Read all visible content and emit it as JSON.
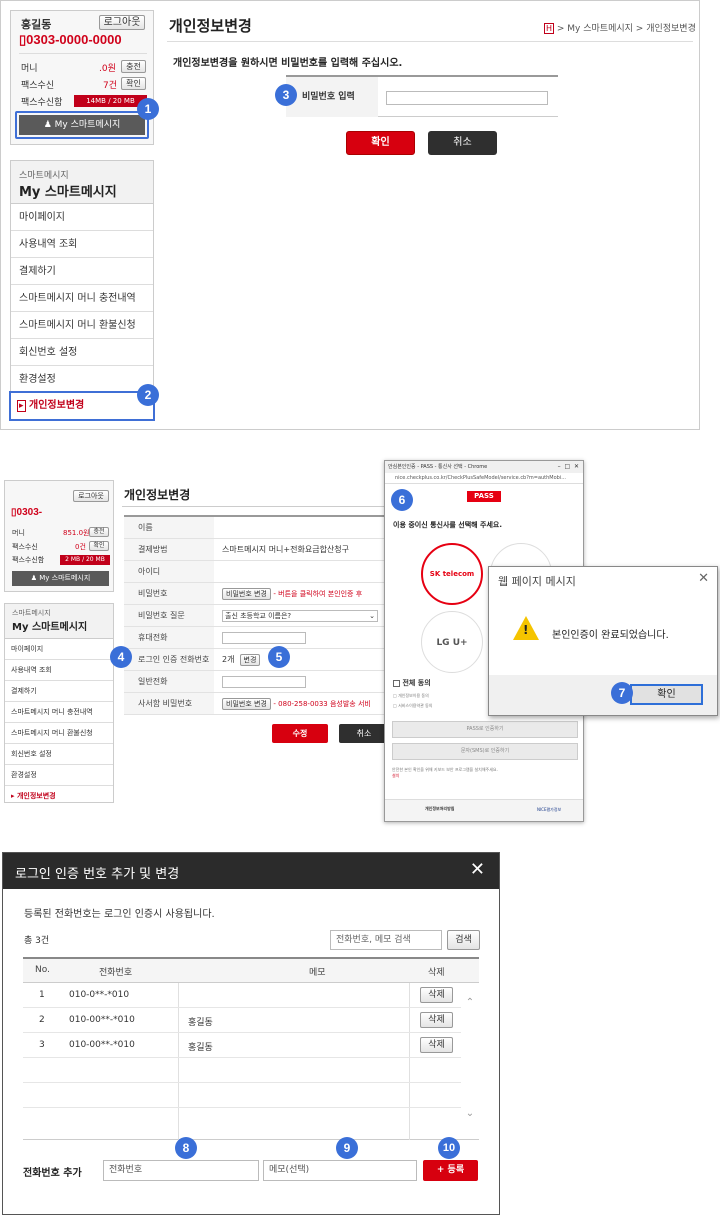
{
  "panel1": {
    "user_name": "홍길동",
    "logout_label": "로그아웃",
    "phone": "0303-0000-0000",
    "money_label": "머니",
    "money_value": ".0원",
    "charge_label": "충전",
    "fax_label": "팩스수신",
    "fax_value": "7건",
    "confirm_label": "확인",
    "faxbox_label": "팩스수신함",
    "faxbox_value": "14MB / 20 MB",
    "my_btn": "My 스마트메시지",
    "page_title": "개인정보변경",
    "breadcrumb": "> My 스마트메시지 > 개인정보변경",
    "instruction": "개인정보변경을 원하시면 비밀번호를 입력해 주십시오.",
    "password_label": "비밀번호 입력",
    "ok_btn": "확인",
    "cancel_btn": "취소",
    "sidebar_sub": "스마트메시지",
    "sidebar_title": "My 스마트메시지",
    "menu": [
      "마이페이지",
      "사용내역 조회",
      "결제하기",
      "스마트메시지 머니 충전내역",
      "스마트메시지 머니 환불신청",
      "회신번호 설정",
      "환경설정",
      "개인정보변경"
    ]
  },
  "panel2": {
    "logout_label": "로그아웃",
    "phone": "0303-",
    "money_label": "머니",
    "money_value": "851.0원",
    "charge_label": "충전",
    "fax_label": "팩스수신",
    "fax_value": "0건",
    "confirm_label": "확인",
    "faxbox_label": "팩스수신함",
    "faxbox_value": "2 MB / 20 MB",
    "my_btn": "My 스마트메시지",
    "sidebar_sub": "스마트메시지",
    "sidebar_title": "My 스마트메시지",
    "menu": [
      "마이페이지",
      "사용내역 조회",
      "결제하기",
      "스마트메시지 머니 충전내역",
      "스마트메시지 머니 환불신청",
      "회신번호 설정",
      "환경설정",
      "개인정보변경"
    ],
    "page_title": "개인정보변경",
    "rows": [
      {
        "label": "이름",
        "value": ""
      },
      {
        "label": "결제방법",
        "value": "스마트메시지 머니+전화요금합산청구"
      },
      {
        "label": "아이디",
        "value": ""
      },
      {
        "label": "비밀번호",
        "btn": "비밀번호 변경",
        "note": "- 버튼을 클릭하여 본인인증 후"
      },
      {
        "label": "비밀번호 질문",
        "select": "출신 초등학교 이름은?"
      },
      {
        "label": "휴대전화",
        "value": ""
      },
      {
        "label": "로그인 인증 전화번호",
        "value": "2개",
        "btn": "변경"
      },
      {
        "label": "일반전화",
        "value": ""
      },
      {
        "label": "사서함 비밀번호",
        "btn": "비밀번호 변경",
        "note": "- 080-258-0033 음성발송 서비"
      }
    ],
    "modify_btn": "수정",
    "cancel_btn": "취소"
  },
  "browser": {
    "title": "안심본인인증 - PASS - 통신사 선택 - Chrome",
    "url": "nice.checkplus.co.kr/CheckPlusSafeModel/service.cb?m=authMobi...",
    "pass_logo": "PASS",
    "heading": "이용 중이신 통신사를 선택해 주세요.",
    "sk_label": "SK telecom",
    "lg_label": "LG U+",
    "agree_all": "전체 동의",
    "agree_items": [
      "개인정보이용 동의",
      "서비스이용약관 동의"
    ],
    "pass_auth": "PASS로 인증하기",
    "sms_auth": "문자(SMS)로 인증하기",
    "note": "안전한 본인 확인을 위해 키보드 보안 프로그램을 설치해주세요.",
    "install": "설치",
    "footer_text": "개인정보처리방침",
    "nice_logo": "NICE평가정보"
  },
  "dialog": {
    "title": "웹 페이지 메시지",
    "message": "본인인증이 완료되었습니다.",
    "ok": "확인"
  },
  "modal": {
    "title": "로그인 인증 번호 추가 및 변경",
    "desc": "등록된 전화번호는 로그인 인증시 사용됩니다.",
    "total": "총 3건",
    "search_placeholder": "전화번호, 메모 검색",
    "search_btn": "검색",
    "headers": [
      "No.",
      "전화번호",
      "메모",
      "삭제"
    ],
    "rows": [
      {
        "no": "1",
        "phone": "010-0**-*010",
        "memo": "",
        "del": "삭제"
      },
      {
        "no": "2",
        "phone": "010-00**-*010",
        "memo": "홍길동",
        "del": "삭제"
      },
      {
        "no": "3",
        "phone": "010-00**-*010",
        "memo": "홍길동",
        "del": "삭제"
      }
    ],
    "add_label": "전화번호 추가",
    "phone_placeholder": "전화번호",
    "memo_placeholder": "메모(선택)",
    "register_btn": "+ 등록"
  },
  "markers": [
    "1",
    "2",
    "3",
    "4",
    "5",
    "6",
    "7",
    "8",
    "9",
    "10"
  ],
  "colors": {
    "accent_red": "#d0021b",
    "marker_blue": "#3a6fd8",
    "highlight_blue": "#3f6fd6",
    "dark_btn": "#2f2f2f",
    "modal_header": "#2b2b2b"
  }
}
